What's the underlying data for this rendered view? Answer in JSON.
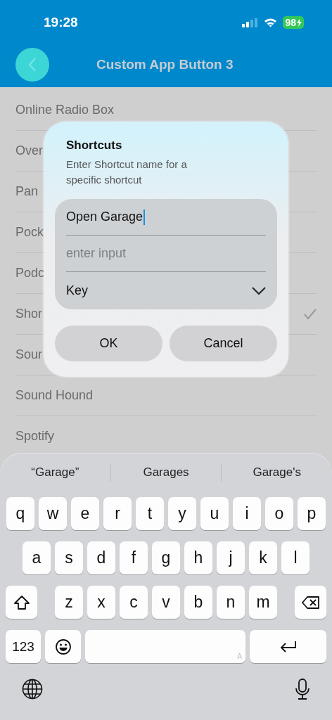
{
  "status_bar": {
    "time": "19:28",
    "battery": "98",
    "charging": true
  },
  "header": {
    "title": "Custom App Button 3"
  },
  "list": {
    "items": [
      {
        "label": "Online Radio Box",
        "selected": false
      },
      {
        "label": "Over",
        "selected": false
      },
      {
        "label": "Pan",
        "selected": false
      },
      {
        "label": "Pock",
        "selected": false
      },
      {
        "label": "Podc",
        "selected": false
      },
      {
        "label": "Shor",
        "selected": true
      },
      {
        "label": "Sour",
        "selected": false
      },
      {
        "label": "Sound Hound",
        "selected": false
      },
      {
        "label": "Spotify",
        "selected": false
      }
    ]
  },
  "dialog": {
    "title": "Shortcuts",
    "message": "Enter Shortcut name for a specific shortcut",
    "fields": [
      {
        "kind": "text",
        "value": "Open Garage",
        "focused": true
      },
      {
        "kind": "text",
        "placeholder": "enter input",
        "focused": false
      },
      {
        "kind": "select",
        "value": "Key"
      }
    ],
    "buttons": [
      "OK",
      "Cancel"
    ]
  },
  "keyboard": {
    "suggestions": [
      "“Garage”",
      "Garages",
      "Garage's"
    ],
    "rows": [
      [
        "q",
        "w",
        "e",
        "r",
        "t",
        "y",
        "u",
        "i",
        "o",
        "p"
      ],
      [
        "a",
        "s",
        "d",
        "f",
        "g",
        "h",
        "j",
        "k",
        "l"
      ],
      [
        "z",
        "x",
        "c",
        "v",
        "b",
        "n",
        "m"
      ]
    ],
    "number_key": "123",
    "space_hint": "A"
  }
}
